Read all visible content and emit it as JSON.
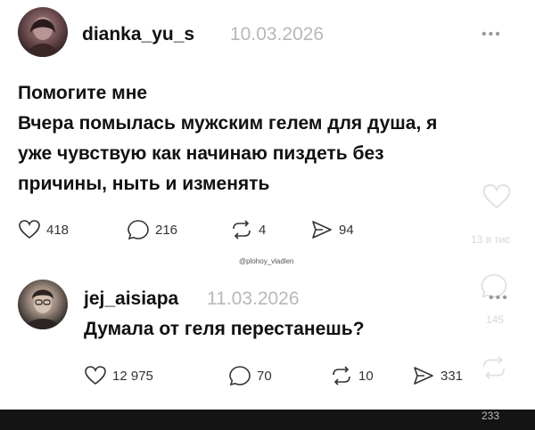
{
  "post1": {
    "username": "dianka_yu_s",
    "date": "10.03.2026",
    "more": "•••",
    "text_lines": [
      "Помогите мне",
      "Вчера помылась мужским гелем для душа, я",
      "уже чувствую как начинаю пиздеть без",
      "причины, ныть и изменять"
    ],
    "likes": "418",
    "comments": "216",
    "reposts": "4",
    "shares": "94"
  },
  "watermark": "@plohoy_vladlen",
  "post2": {
    "username": "jej_aisiapa",
    "date": "11.03.2026",
    "more": "•••",
    "text": "Думала от геля перестанешь?",
    "likes": "12 975",
    "comments": "70",
    "reposts": "10",
    "shares": "331"
  },
  "ghost": {
    "time": "13 в тис",
    "count_a": "145",
    "count_b": "233"
  },
  "colors": {
    "date": "#b8b8b8",
    "text": "#111111",
    "bar": "#141414"
  }
}
